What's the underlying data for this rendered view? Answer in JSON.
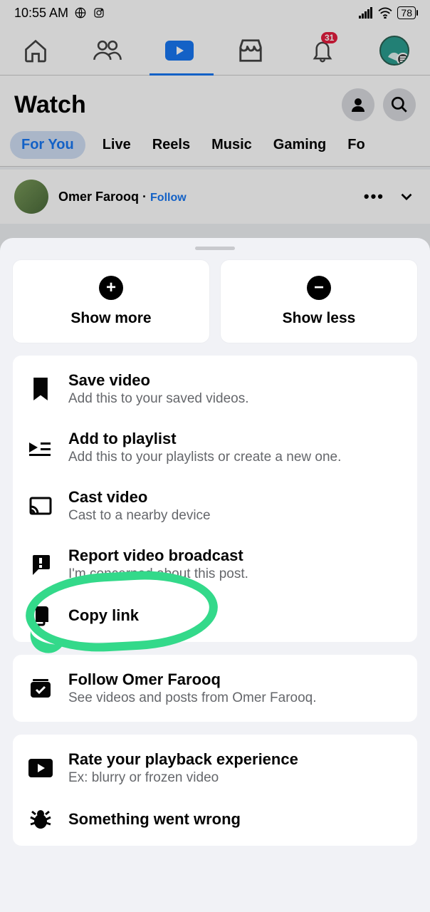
{
  "status": {
    "time": "10:55 AM",
    "battery": "78"
  },
  "nav": {
    "notif_count": "31"
  },
  "header": {
    "title": "Watch"
  },
  "tabs": [
    "For You",
    "Live",
    "Reels",
    "Music",
    "Gaming",
    "Fo"
  ],
  "post": {
    "author": "Omer Farooq",
    "dot": " · ",
    "follow": "Follow"
  },
  "sheet": {
    "show_more": "Show more",
    "show_less": "Show less",
    "items": [
      {
        "title": "Save video",
        "sub": "Add this to your saved videos."
      },
      {
        "title": "Add to playlist",
        "sub": "Add this to your playlists or create a new one."
      },
      {
        "title": "Cast video",
        "sub": "Cast to a nearby device"
      },
      {
        "title": "Report video broadcast",
        "sub": "I'm concerned about this post."
      },
      {
        "title": "Copy link",
        "sub": ""
      }
    ],
    "follow": {
      "title": "Follow Omer Farooq",
      "sub": "See videos and posts from Omer Farooq."
    },
    "rate": {
      "title": "Rate your playback experience",
      "sub": "Ex: blurry or frozen video"
    },
    "wrong": {
      "title": "Something went wrong",
      "sub": ""
    }
  }
}
